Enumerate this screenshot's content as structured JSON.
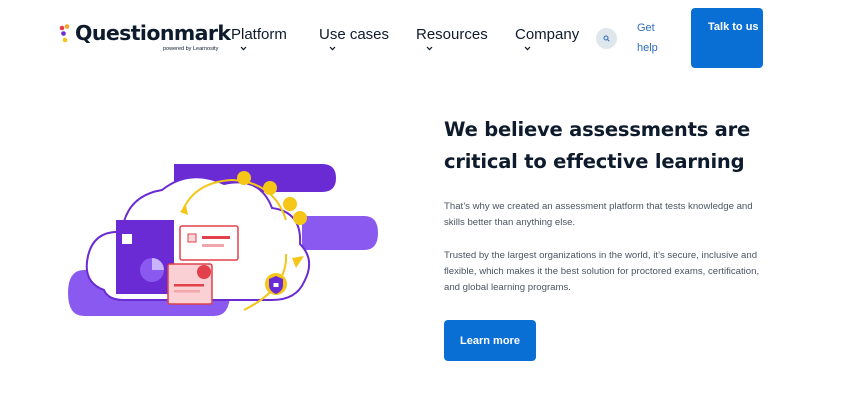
{
  "header": {
    "brand": "Questionmark",
    "brand_sub": "powered by Learnosity",
    "nav": [
      {
        "label": "Platform"
      },
      {
        "label": "Use cases"
      },
      {
        "label": "Resources"
      },
      {
        "label": "Company"
      }
    ],
    "help_label": "Get help",
    "cta_label": "Talk to us"
  },
  "hero": {
    "title": "We believe assessments are critical to effective learning",
    "paragraph1": "That’s why we created an assessment platform that tests knowledge and skills better than anything else.",
    "paragraph2": "Trusted by the largest organizations in the world, it’s secure, inclusive and flexible, which makes it the best solution for proctored exams, certification, and global learning programs.",
    "button_label": "Learn more"
  },
  "colors": {
    "accent": "#0a6fd4",
    "text": "#0e1b2c",
    "purple": "#6a2bd4",
    "yellow": "#f5c518",
    "red": "#e2404a"
  },
  "icons": [
    "search-icon",
    "chevron-down-icon",
    "excel-icon",
    "shield-lock-icon",
    "puzzle-icon",
    "wifi-icon",
    "certificate-icon",
    "user-icon"
  ]
}
